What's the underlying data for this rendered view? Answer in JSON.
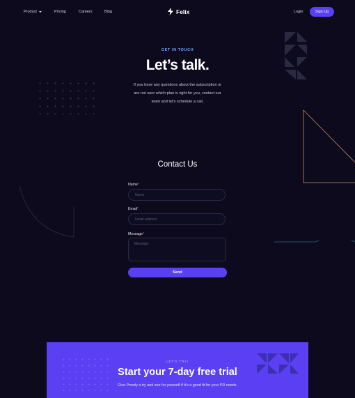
{
  "nav": {
    "product": "Product",
    "pricing": "Pricing",
    "careers": "Careers",
    "blog": "Blog",
    "brand": "Felix",
    "login": "Login",
    "signup": "Sign Up"
  },
  "hero": {
    "eyebrow": "GET IN TOUCH",
    "title": "Let’s talk.",
    "line1": "If you have any questions about the subscription or",
    "line2": "are not sure which plan is right for you, contact our",
    "line3": "team and let’s schedule a call."
  },
  "contact": {
    "title": "Contact Us",
    "name_label": "Name",
    "name_placeholder": "Name",
    "email_label": "Email",
    "email_placeholder": "Email address",
    "message_label": "Message",
    "message_placeholder": "Message",
    "required_mark": "*",
    "send": "Send"
  },
  "cta": {
    "eyebrow": "LET’S TRY!",
    "title": "Start your 7-day free trial",
    "text": "Give Prowly a try and see for yourself if it’s a good fit for your PR needs."
  },
  "colors": {
    "background": "#0c0a1c",
    "accent": "#5b3ff3",
    "eyebrow": "#6fa0ff"
  }
}
